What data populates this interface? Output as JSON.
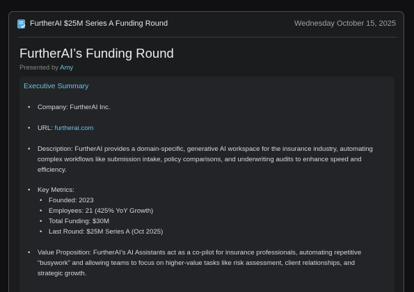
{
  "header": {
    "title": "FurtherAI $25M Series A Funding Round",
    "date": "Wednesday October 15, 2025"
  },
  "page": {
    "title": "FurtherAI’s Funding Round",
    "presented_by_prefix": "Presented by",
    "presenter": "Amy"
  },
  "summary": {
    "heading": "Executive Summary",
    "company_label": "Company:",
    "company_value": "FurtherAI Inc.",
    "url_label": "URL:",
    "url_value": "furtherai.com",
    "description_label": "Description:",
    "description_value": "FurtherAI provides a domain-specific, generative AI workspace for the insurance industry, automating complex workflows like submission intake, policy comparisons, and underwriting audits to enhance speed and efficiency.",
    "metrics_label": "Key Metrics:",
    "metrics": [
      {
        "label": "Founded:",
        "value": "2023"
      },
      {
        "label": "Employees:",
        "value": "21 (425% YoY Growth)"
      },
      {
        "label": "Total Funding:",
        "value": "$30M"
      },
      {
        "label": "Last Round:",
        "value": "$25M Series A (Oct 2025)"
      }
    ],
    "value_prop_label": "Value Proposition:",
    "value_prop_value": "FurtherAI’s AI Assistants act as a co-pilot for insurance professionals, automating repetitive “busywork” and allowing teams to focus on higher-value tasks like risk assessment, client relationships, and strategic growth."
  },
  "colors": {
    "accent": "#6cc3de",
    "background": "#1b1c1e",
    "card": "#232427"
  },
  "icons": {
    "header": "document-check-icon"
  }
}
